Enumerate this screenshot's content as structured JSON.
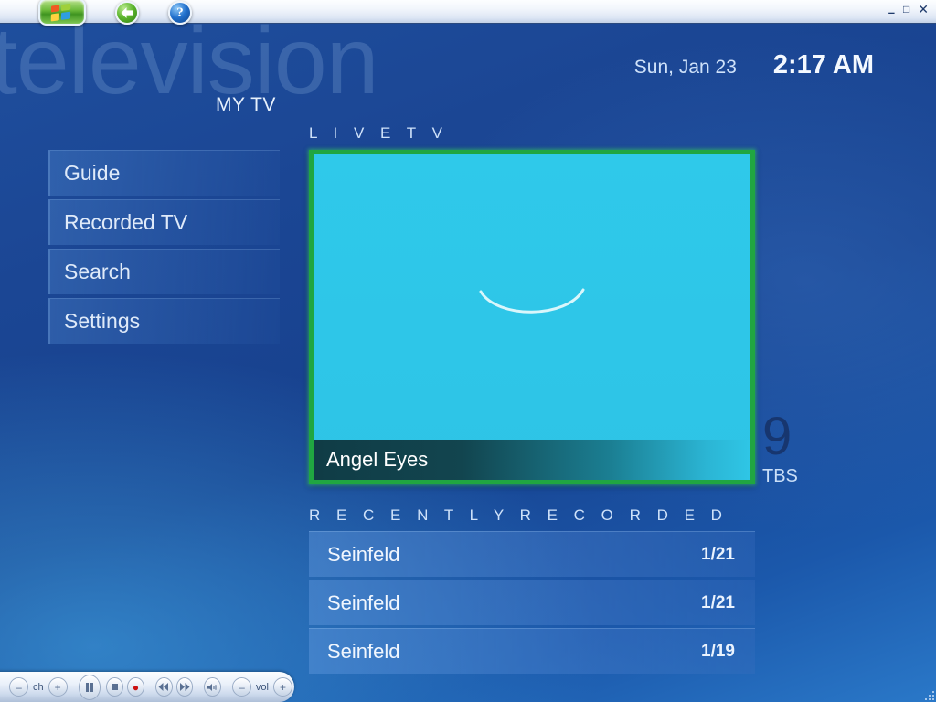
{
  "window": {
    "watermark": "television",
    "controls": {
      "minimize": "–",
      "maximize": "□",
      "close": "✕"
    },
    "start_button": "start-orb",
    "back_button": "back-arrow",
    "help_button": "?"
  },
  "header": {
    "date": "Sun, Jan 23",
    "time": "2:17 AM",
    "section": "MY TV"
  },
  "menu": {
    "items": [
      {
        "label": "Guide"
      },
      {
        "label": "Recorded TV"
      },
      {
        "label": "Search"
      },
      {
        "label": "Settings"
      }
    ]
  },
  "live_tv": {
    "label": "L I V E   T V",
    "program_title": "Angel Eyes",
    "channel_number": "9",
    "channel_name": "TBS",
    "selection_color": "#20a641",
    "video_color": "#2ec6e8"
  },
  "recently_recorded": {
    "label": "R E C E N T L Y   R E C O R D E D",
    "rows": [
      {
        "title": "Seinfeld",
        "date": "1/21"
      },
      {
        "title": "Seinfeld",
        "date": "1/21"
      },
      {
        "title": "Seinfeld",
        "date": "1/19"
      }
    ]
  },
  "transport": {
    "channel_down": "–",
    "channel_label": "ch",
    "channel_up": "+",
    "pause": "pause",
    "stop": "stop",
    "record": "●",
    "rewind": "◀◀",
    "forward": "▶▶",
    "mute": "◂",
    "volume_down": "–",
    "volume_label": "vol",
    "volume_up": "+"
  }
}
